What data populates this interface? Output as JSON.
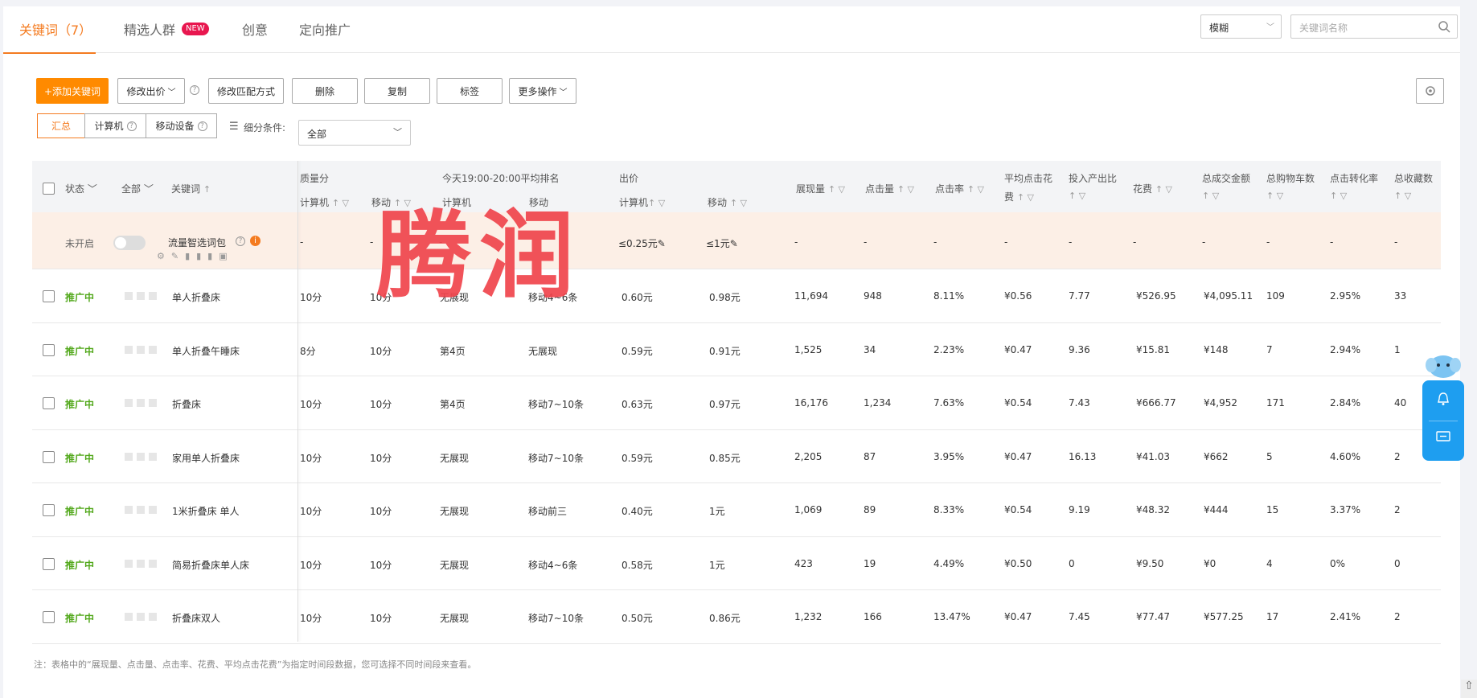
{
  "tabs": {
    "keywords": "关键词（7）",
    "crowd": "精选人群",
    "new_badge": "NEW",
    "creative": "创意",
    "targeting": "定向推广"
  },
  "search": {
    "match_mode": "模糊",
    "placeholder": "关键词名称"
  },
  "toolbar": {
    "add_keyword": "+添加关键词",
    "modify_bid": "修改出价",
    "modify_match": "修改匹配方式",
    "delete": "删除",
    "copy": "复制",
    "tag": "标签",
    "more": "更多操作"
  },
  "segments": {
    "summary": "汇总",
    "computer": "计算机",
    "mobile": "移动设备"
  },
  "filter": {
    "label": "细分条件:",
    "value": "全部"
  },
  "headers": {
    "status": "状态",
    "all": "全部",
    "keyword": "关键词",
    "quality": "质量分",
    "q_pc": "计算机",
    "q_mobile": "移动",
    "rank_title": "今天19:00-20:00平均排名",
    "r_pc": "计算机",
    "r_mobile": "移动",
    "bid": "出价",
    "b_pc": "计算机",
    "b_mobile": "移动",
    "impressions": "展现量",
    "clicks": "点击量",
    "ctr": "点击率",
    "avg_cpc_1": "平均点击花",
    "avg_cpc_2": "费",
    "roi": "投入产出比",
    "spend": "花费",
    "gmv": "总成交金额",
    "cart": "总购物车数",
    "cvr": "点击转化率",
    "fav": "总收藏数"
  },
  "package_row": {
    "status": "未开启",
    "name": "流量智选词包",
    "q_pc": "-",
    "q_mobile": "-",
    "r_pc": "-",
    "b_pc": "≤0.25元",
    "b_mobile": "≤1元",
    "dash": "-"
  },
  "rows": [
    {
      "status": "推广中",
      "keyword": "单人折叠床",
      "q_pc": "10分",
      "q_mobile": "10分",
      "r_pc": "无展现",
      "r_mobile": "移动4~6条",
      "b_pc": "0.60元",
      "b_mobile": "0.98元",
      "impressions": "11,694",
      "clicks": "948",
      "ctr": "8.11%",
      "cpc": "¥0.56",
      "roi": "7.77",
      "spend": "¥526.95",
      "gmv": "¥4,095.11",
      "cart": "109",
      "cvr": "2.95%",
      "fav": "33"
    },
    {
      "status": "推广中",
      "keyword": "单人折叠午睡床",
      "q_pc": "8分",
      "q_mobile": "10分",
      "r_pc": "第4页",
      "r_mobile": "无展现",
      "b_pc": "0.59元",
      "b_mobile": "0.91元",
      "impressions": "1,525",
      "clicks": "34",
      "ctr": "2.23%",
      "cpc": "¥0.47",
      "roi": "9.36",
      "spend": "¥15.81",
      "gmv": "¥148",
      "cart": "7",
      "cvr": "2.94%",
      "fav": "1"
    },
    {
      "status": "推广中",
      "keyword": "折叠床",
      "q_pc": "10分",
      "q_mobile": "10分",
      "r_pc": "第4页",
      "r_mobile": "移动7~10条",
      "b_pc": "0.63元",
      "b_mobile": "0.97元",
      "impressions": "16,176",
      "clicks": "1,234",
      "ctr": "7.63%",
      "cpc": "¥0.54",
      "roi": "7.43",
      "spend": "¥666.77",
      "gmv": "¥4,952",
      "cart": "171",
      "cvr": "2.84%",
      "fav": "40"
    },
    {
      "status": "推广中",
      "keyword": "家用单人折叠床",
      "q_pc": "10分",
      "q_mobile": "10分",
      "r_pc": "无展现",
      "r_mobile": "移动7~10条",
      "b_pc": "0.59元",
      "b_mobile": "0.85元",
      "impressions": "2,205",
      "clicks": "87",
      "ctr": "3.95%",
      "cpc": "¥0.47",
      "roi": "16.13",
      "spend": "¥41.03",
      "gmv": "¥662",
      "cart": "5",
      "cvr": "4.60%",
      "fav": "2"
    },
    {
      "status": "推广中",
      "keyword": "1米折叠床 单人",
      "q_pc": "10分",
      "q_mobile": "10分",
      "r_pc": "无展现",
      "r_mobile": "移动前三",
      "b_pc": "0.40元",
      "b_mobile": "1元",
      "impressions": "1,069",
      "clicks": "89",
      "ctr": "8.33%",
      "cpc": "¥0.54",
      "roi": "9.19",
      "spend": "¥48.32",
      "gmv": "¥444",
      "cart": "15",
      "cvr": "3.37%",
      "fav": "2"
    },
    {
      "status": "推广中",
      "keyword": "简易折叠床单人床",
      "q_pc": "10分",
      "q_mobile": "10分",
      "r_pc": "无展现",
      "r_mobile": "移动4~6条",
      "b_pc": "0.58元",
      "b_mobile": "1元",
      "impressions": "423",
      "clicks": "19",
      "ctr": "4.49%",
      "cpc": "¥0.50",
      "roi": "0",
      "spend": "¥9.50",
      "gmv": "¥0",
      "cart": "4",
      "cvr": "0%",
      "fav": "0"
    },
    {
      "status": "推广中",
      "keyword": "折叠床双人",
      "q_pc": "10分",
      "q_mobile": "10分",
      "r_pc": "无展现",
      "r_mobile": "移动7~10条",
      "b_pc": "0.50元",
      "b_mobile": "0.86元",
      "impressions": "1,232",
      "clicks": "166",
      "ctr": "13.47%",
      "cpc": "¥0.47",
      "roi": "7.45",
      "spend": "¥77.47",
      "gmv": "¥577.25",
      "cart": "17",
      "cvr": "2.41%",
      "fav": "2"
    }
  ],
  "footnote": "注：表格中的“展现量、点击量、点击率、花费、平均点击花费”为指定时间段数据，您可选择不同时间段来查看。",
  "watermark": "腾润",
  "colors": {
    "accent": "#f47b20",
    "status_on": "#52a81b",
    "package_bg": "#fcefe6",
    "float_blue": "#1e9ef0"
  }
}
